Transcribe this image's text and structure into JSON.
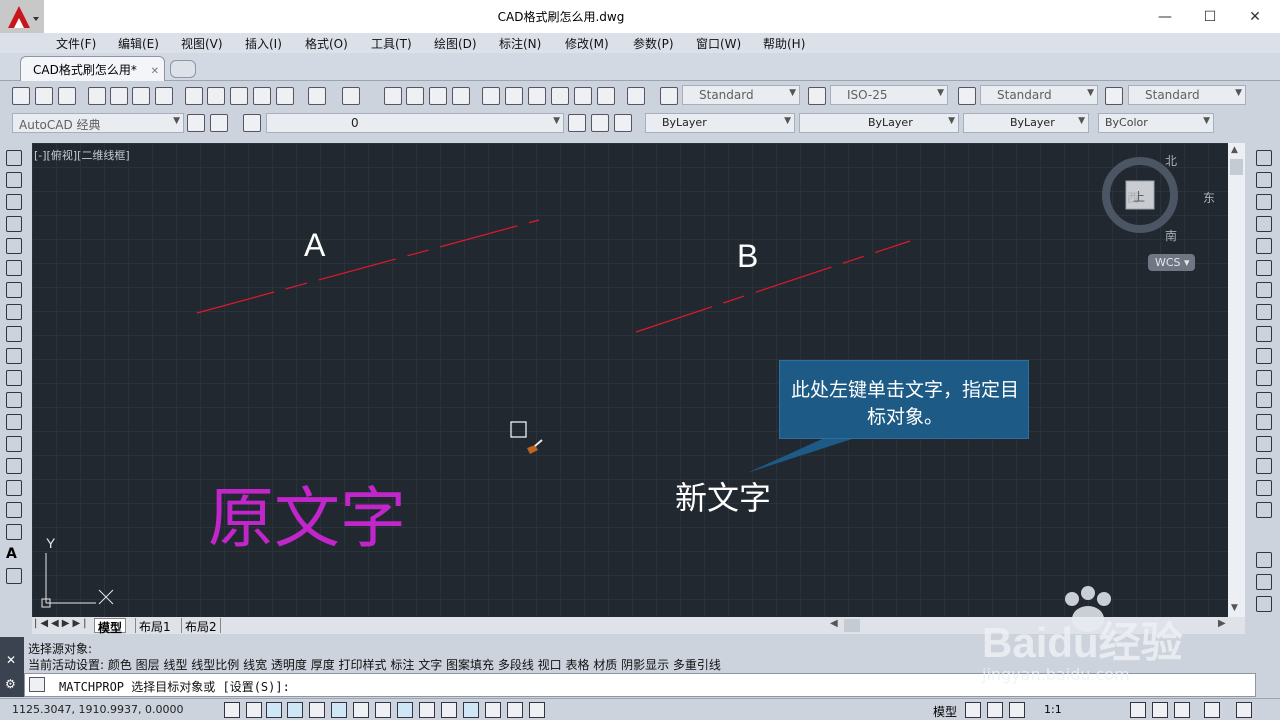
{
  "window": {
    "title": "CAD格式刷怎么用.dwg",
    "min_label": "—",
    "max_label": "☐",
    "close_label": "✕"
  },
  "menu": [
    "文件(F)",
    "编辑(E)",
    "视图(V)",
    "插入(I)",
    "格式(O)",
    "工具(T)",
    "绘图(D)",
    "标注(N)",
    "修改(M)",
    "参数(P)",
    "窗口(W)",
    "帮助(H)"
  ],
  "doc_tab": {
    "label": "CAD格式刷怎么用*",
    "close": "✕"
  },
  "toolbar1": {
    "text_style": "Standard",
    "dim_style": "ISO-25",
    "table_style": "Standard",
    "mleader_style": "Standard"
  },
  "toolbar2": {
    "workspace": "AutoCAD 经典",
    "layer": "0",
    "color": "ByLayer",
    "linetype": "ByLayer",
    "lineweight": "ByLayer",
    "plotstyle": "ByColor"
  },
  "viewport": {
    "label": "[-][俯视][二维线框]",
    "label_a": "A",
    "label_b": "B",
    "text_source": "原文字",
    "text_target": "新文字",
    "callout": "此处左键单击文字，指定目标对象。",
    "ucs_x": "X",
    "ucs_y": "Y"
  },
  "viewcube": {
    "north": "北",
    "south": "南",
    "east": "东",
    "west": "西",
    "face": "上",
    "wcs": "WCS"
  },
  "layout_tabs": [
    "模型",
    "布局1",
    "布局2"
  ],
  "command": {
    "history1": "选择源对象:",
    "history2": "当前活动设置:  颜色 图层 线型 线型比例 线宽 透明度 厚度 打印样式 标注 文字 图案填充 多段线 视口 表格 材质 阴影显示 多重引线",
    "prompt": "MATCHPROP 选择目标对象或 [设置(S)]:"
  },
  "status": {
    "coords": "1125.3047, 1910.9937, 0.0000",
    "model": "模型",
    "scale": "1:1"
  },
  "watermark": {
    "brand": "Baidu经验",
    "url": "jingyan.baidu.com"
  },
  "colors": {
    "canvas": "#212830",
    "dashed_line": "#e0192b",
    "source_text": "#c026c9",
    "callout": "#1d5a86"
  }
}
